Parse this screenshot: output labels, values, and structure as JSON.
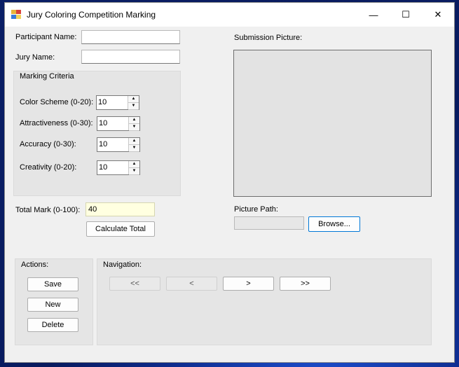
{
  "window": {
    "title": "Jury Coloring Competition Marking"
  },
  "titlebar": {
    "minimize_glyph": "—",
    "maximize_glyph": "☐",
    "close_glyph": "✕"
  },
  "form": {
    "participant_label": "Participant Name:",
    "participant_value": "",
    "jury_label": "Jury Name:",
    "jury_value": ""
  },
  "criteria": {
    "title": "Marking Criteria",
    "items": [
      {
        "label": "Color Scheme (0-20):",
        "value": "10"
      },
      {
        "label": "Attractiveness (0-30):",
        "value": "10"
      },
      {
        "label": "Accuracy (0-30):",
        "value": "10"
      },
      {
        "label": "Creativity (0-20):",
        "value": "10"
      }
    ],
    "spin_up": "▲",
    "spin_down": "▼"
  },
  "total": {
    "label": "Total Mark (0-100):",
    "value": "40",
    "calculate_label": "Calculate Total"
  },
  "picture": {
    "label": "Submission Picture:",
    "path_label": "Picture Path:",
    "path_value": "",
    "browse_label": "Browse..."
  },
  "actions": {
    "title": "Actions:",
    "save": "Save",
    "new": "New",
    "delete": "Delete"
  },
  "navigation": {
    "title": "Navigation:",
    "first": "<<",
    "prev": "<",
    "next": ">",
    "last": ">>"
  }
}
